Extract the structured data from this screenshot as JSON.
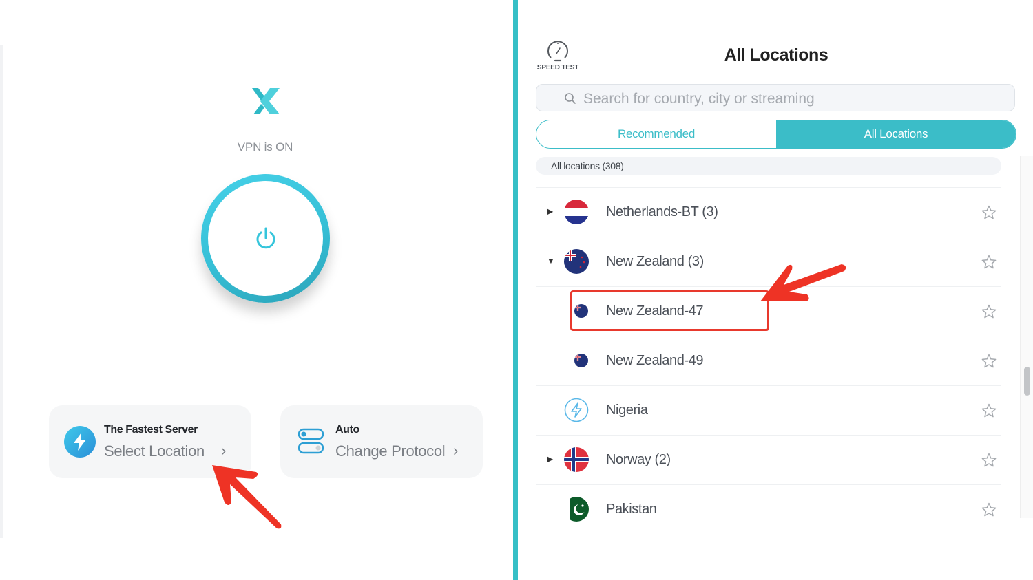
{
  "left": {
    "status_text": "VPN is ON",
    "location_card": {
      "title": "The Fastest Server",
      "subtitle": "Select Location",
      "chevron": "›",
      "icon": "bolt-icon"
    },
    "protocol_card": {
      "title": "Auto",
      "subtitle": "Change Protocol",
      "chevron": "›",
      "icon": "toggle-icon"
    }
  },
  "right": {
    "speed_test_label": "SPEED TEST",
    "title": "All Locations",
    "search_placeholder": "Search for country, city or streaming",
    "search_value": "",
    "tabs": [
      {
        "label": "Recommended",
        "active": false
      },
      {
        "label": "All Locations",
        "active": true
      }
    ],
    "section_header": "All locations (308)",
    "locations": [
      {
        "name": "Netherlands-BT (3)",
        "flag": "netherlands",
        "expander": "▶",
        "favorite": false
      },
      {
        "name": "New Zealand (3)",
        "flag": "new-zealand",
        "expander": "▼",
        "favorite": false
      },
      {
        "name": "New Zealand-47",
        "flag": "new-zealand",
        "expander": "",
        "favorite": false,
        "highlighted": true,
        "child": true
      },
      {
        "name": "New Zealand-49",
        "flag": "new-zealand",
        "expander": "",
        "favorite": false,
        "child": true
      },
      {
        "name": "Nigeria",
        "flag": "fastest-bolt",
        "expander": "",
        "favorite": false
      },
      {
        "name": "Norway (2)",
        "flag": "norway",
        "expander": "▶",
        "favorite": false
      },
      {
        "name": "Pakistan",
        "flag": "pakistan",
        "expander": "",
        "favorite": false
      }
    ]
  },
  "colors": {
    "accent": "#36bfc6",
    "annotation_red": "#e8392d"
  }
}
